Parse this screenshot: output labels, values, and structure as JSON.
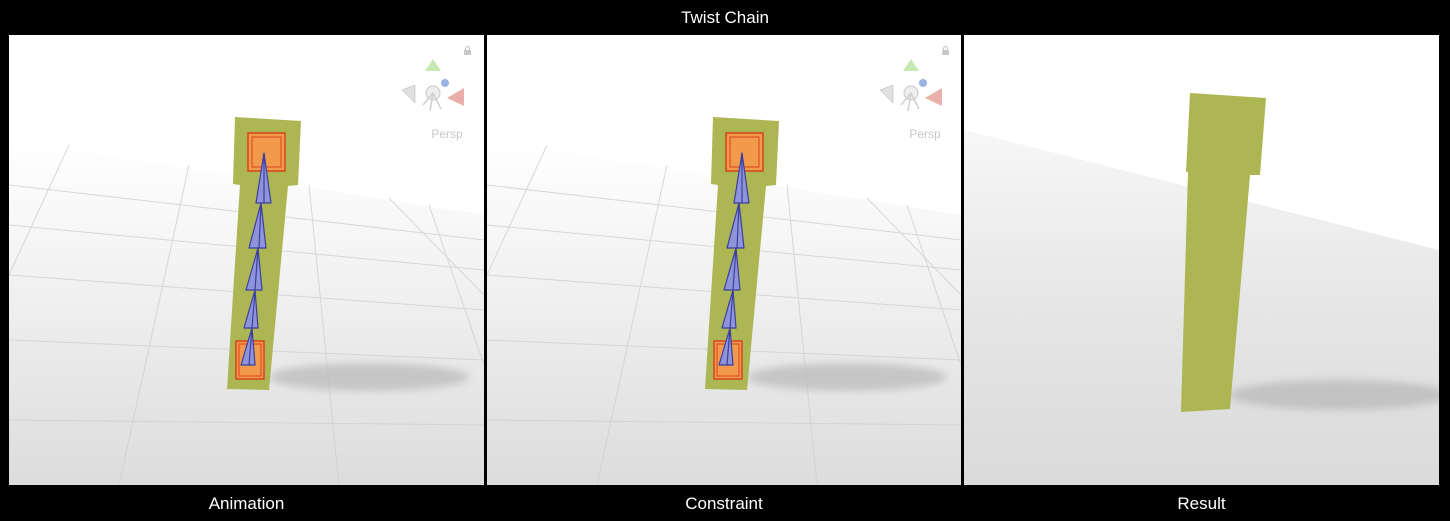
{
  "title": "Twist Chain",
  "panels": [
    {
      "label": "Animation",
      "overlay": "Persp",
      "has_gizmo": true,
      "icons": [
        "lock-icon",
        "view-gizmo-icon"
      ]
    },
    {
      "label": "Constraint",
      "overlay": "Persp",
      "has_gizmo": true,
      "icons": [
        "lock-icon",
        "view-gizmo-icon"
      ]
    },
    {
      "label": "Result",
      "has_gizmo": false
    }
  ],
  "colors": {
    "background": "#000000",
    "bar": "#acb653",
    "handle_fill": "#f19a4b",
    "handle_stroke": "#d8421e",
    "bone_fill": "#8f93d9",
    "bone_stroke": "#3b3fa0",
    "ground": "#e6e6e6",
    "grid": "#cfcfcf",
    "shadow": "#bdbdbd"
  }
}
